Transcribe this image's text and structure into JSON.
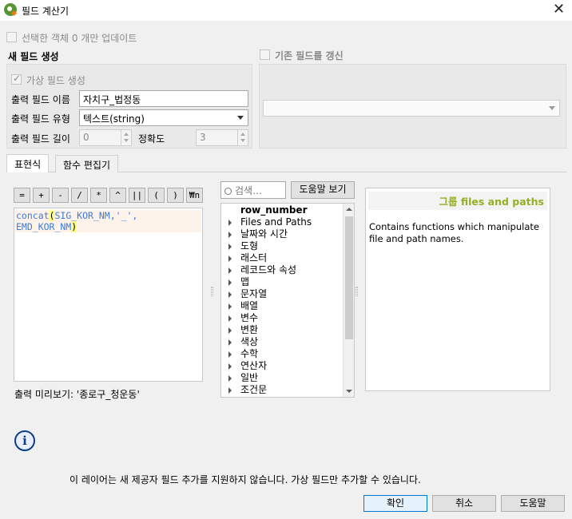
{
  "window": {
    "title": "필드 계산기",
    "close_symbol": "✕",
    "icon": "qgis-icon"
  },
  "update_selected": {
    "label": "선택한 객체 0 개만 업데이트",
    "checked": false,
    "enabled": false
  },
  "new_field": {
    "group_title": "새 필드 생성",
    "virtual_label": "가상 필드 생성",
    "virtual_checked": true,
    "output_name_label": "출력 필드 이름",
    "output_name_value": "자치구_법정동",
    "output_type_label": "출력 필드 유형",
    "output_type_value": "텍스트(string)",
    "output_length_label": "출력 필드 길이",
    "output_length_value": "0",
    "precision_label": "정확도",
    "precision_value": "3"
  },
  "update_existing": {
    "label": "기존 필드를 갱신",
    "checked": false,
    "combo_value": ""
  },
  "tabs": [
    {
      "label": "표현식",
      "active": true
    },
    {
      "label": "함수 편집기",
      "active": false
    }
  ],
  "operators": [
    "=",
    "+",
    "-",
    "/",
    "*",
    "^",
    "||",
    "(",
    ")",
    "₩n"
  ],
  "expression": {
    "line1_func": "concat",
    "line1_open": "(",
    "line1_args": "SIG_KOR_NM,'_',",
    "line2_args": "EMD_KOR_NM",
    "line2_close": ")"
  },
  "preview": "출력 미리보기: '종로구_청운동'",
  "search": {
    "placeholder": "검색…",
    "help_button": "도움말 보기"
  },
  "function_tree": [
    {
      "label": "row_number",
      "expandable": false,
      "bold": true
    },
    {
      "label": "Files and Paths",
      "expandable": true
    },
    {
      "label": "날짜와 시간",
      "expandable": true
    },
    {
      "label": "도형",
      "expandable": true
    },
    {
      "label": "래스터",
      "expandable": true
    },
    {
      "label": "레코드와 속성",
      "expandable": true
    },
    {
      "label": "맵",
      "expandable": true
    },
    {
      "label": "문자열",
      "expandable": true
    },
    {
      "label": "배열",
      "expandable": true
    },
    {
      "label": "변수",
      "expandable": true
    },
    {
      "label": "변환",
      "expandable": true
    },
    {
      "label": "색상",
      "expandable": true
    },
    {
      "label": "수학",
      "expandable": true
    },
    {
      "label": "연산자",
      "expandable": true
    },
    {
      "label": "일반",
      "expandable": true
    },
    {
      "label": "조건문",
      "expandable": true
    }
  ],
  "help_panel": {
    "heading": "그룹 files and paths",
    "body": "Contains functions which manipulate file and path names."
  },
  "info_message": "이 레이어는 새 제공자 필드 추가를 지원하지 않습니다. 가상 필드만 추가할 수 있습니다.",
  "buttons": {
    "ok": "확인",
    "cancel": "취소",
    "help": "도움말"
  },
  "colors": {
    "accent": "#0078d7",
    "help_heading": "#93b023",
    "code": "#3b7dd8",
    "qgis_green": "#589632"
  }
}
